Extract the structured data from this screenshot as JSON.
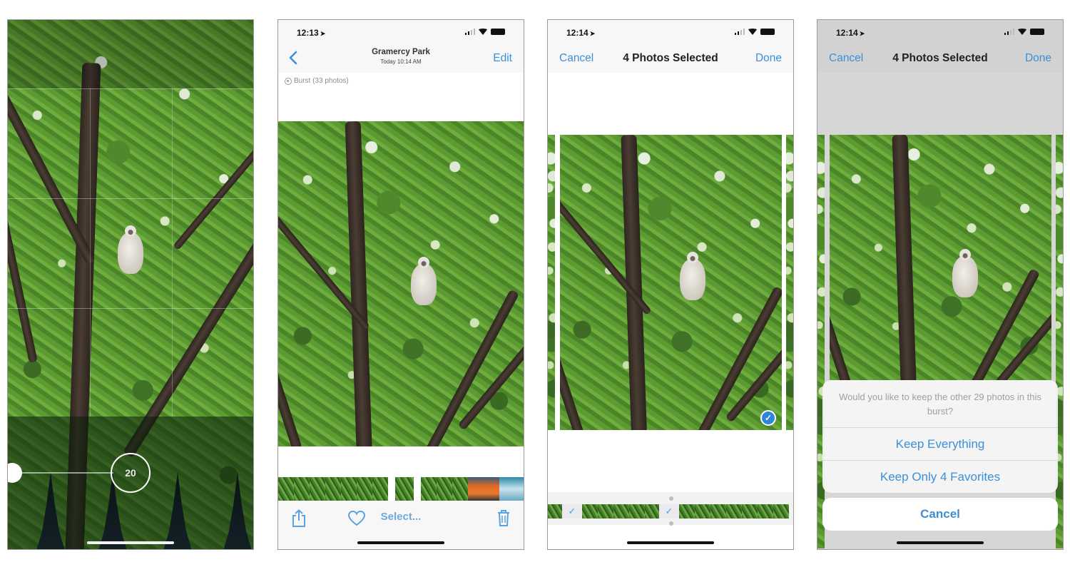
{
  "screens": [
    {
      "id": "camera-burst",
      "burst_count": "20"
    },
    {
      "id": "burst-viewer",
      "status": {
        "time": "12:13"
      },
      "nav": {
        "back_label": "<",
        "title": "Gramercy Park",
        "subtitle": "Today 10:14 AM",
        "edit_label": "Edit"
      },
      "burst_label": "Burst (33 photos)",
      "toolbar": {
        "share_icon": "share-icon",
        "favorite_icon": "heart-icon",
        "select_label": "Select...",
        "trash_icon": "trash-icon"
      }
    },
    {
      "id": "burst-select",
      "status": {
        "time": "12:14"
      },
      "nav": {
        "cancel_label": "Cancel",
        "title": "4 Photos Selected",
        "done_label": "Done"
      },
      "check_glyph": "✓"
    },
    {
      "id": "burst-confirm",
      "status": {
        "time": "12:14"
      },
      "nav": {
        "cancel_label": "Cancel",
        "title": "4 Photos Selected",
        "done_label": "Done"
      },
      "sheet": {
        "message": "Would you like to keep the other 29 photos in this burst?",
        "options": [
          "Keep Everything",
          "Keep Only 4 Favorites"
        ],
        "cancel_label": "Cancel"
      }
    }
  ],
  "colors": {
    "ios_blue": "#3b8fd9",
    "check_blue": "#2f86d8"
  }
}
